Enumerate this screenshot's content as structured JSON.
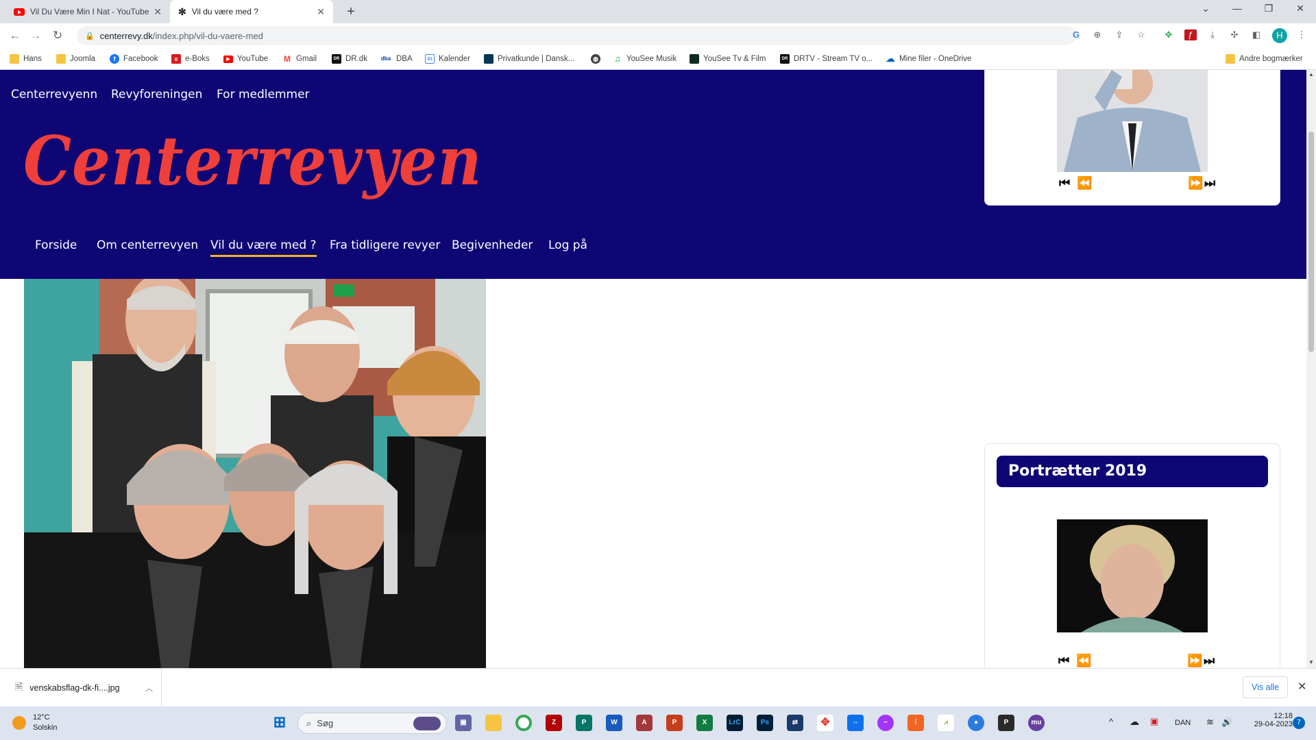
{
  "browser": {
    "tabs": [
      {
        "title": "Vil Du Være Min I Nat - YouTube",
        "icon": "youtube-icon",
        "active": false
      },
      {
        "title": "Vil du være med ?",
        "icon": "joomla-icon",
        "active": true
      }
    ],
    "new_tab_label": "+",
    "url_domain": "centerrevy.dk",
    "url_path": "/index.php/vil-du-vaere-med",
    "profile_initial": "H",
    "bookmarks": [
      {
        "label": "Hans",
        "icon": "folder-icon"
      },
      {
        "label": "Joomla",
        "icon": "folder-icon"
      },
      {
        "label": "Facebook",
        "icon": "facebook-icon"
      },
      {
        "label": "e-Boks",
        "icon": "eboks-icon"
      },
      {
        "label": "YouTube",
        "icon": "youtube-icon"
      },
      {
        "label": "Gmail",
        "icon": "gmail-icon"
      },
      {
        "label": "DR.dk",
        "icon": "dr-icon"
      },
      {
        "label": "DBA",
        "icon": "dba-icon"
      },
      {
        "label": "Kalender",
        "icon": "calendar-icon"
      },
      {
        "label": "Privatkunde | Dansk...",
        "icon": "bank-icon"
      },
      {
        "label": "",
        "icon": "globe-icon"
      },
      {
        "label": "YouSee Musik",
        "icon": "music-icon"
      },
      {
        "label": "YouSee Tv & Film",
        "icon": "yousee-icon"
      },
      {
        "label": "DRTV - Stream TV o...",
        "icon": "drtv-icon"
      },
      {
        "label": "Mine filer - OneDrive",
        "icon": "onedrive-icon"
      }
    ],
    "other_bookmarks": "Andre bogmærker"
  },
  "site": {
    "top_nav": [
      "Centerrevyenn",
      "Revyforeningen",
      "For medlemmer"
    ],
    "logo_text": "Centerrevyen",
    "main_nav": [
      {
        "label": "Forside",
        "active": false
      },
      {
        "label": "Om centerrevyen",
        "active": false
      },
      {
        "label": "Vil du være med ?",
        "active": true
      },
      {
        "label": "Fra tidligere revyer",
        "active": false
      },
      {
        "label": "Begivenheder",
        "active": false
      },
      {
        "label": "Log på",
        "active": false
      }
    ],
    "colors": {
      "header_bg": "#0f0675",
      "logo": "#ef3f3a",
      "active_underline": "#f0b819"
    }
  },
  "sidebar": {
    "module2_title": "Portrætter 2019",
    "slider_controls": {
      "first": "⏮",
      "prev": "⏪",
      "next": "⏩",
      "last": "⏭"
    }
  },
  "download_bar": {
    "file_name": "venskabsflag-dk-fi....jpg",
    "show_all": "Vis alle"
  },
  "taskbar": {
    "temperature": "12°C",
    "weather": "Solskin",
    "search_placeholder": "Søg",
    "language": "DAN",
    "time": "12:18",
    "date": "29-04-2023",
    "notifications": "7"
  }
}
